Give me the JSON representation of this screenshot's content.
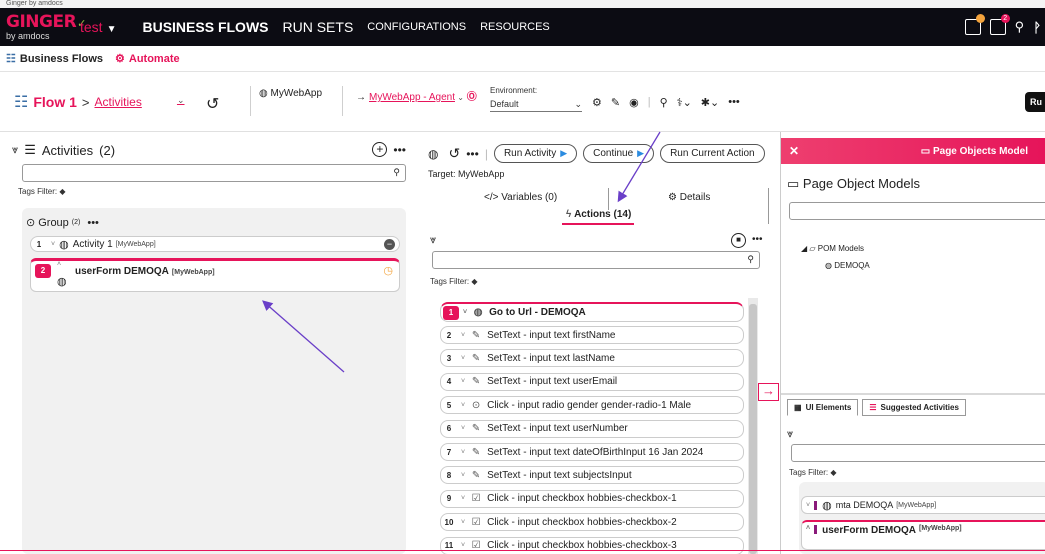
{
  "window": {
    "title": "Ginger by amdocs"
  },
  "brand": {
    "logo": "GINGER",
    "sub": "by amdocs"
  },
  "topnav": {
    "solution": "test",
    "items": [
      "BUSINESS FLOWS",
      "RUN SETS",
      "CONFIGURATIONS",
      "RESOURCES"
    ],
    "notification_count": "2"
  },
  "subbar": {
    "business_flows": "Business Flows",
    "automate": "Automate"
  },
  "toolbar": {
    "flow_name": "Flow 1",
    "flow_sep": ">",
    "view": "Activities",
    "app": "MyWebApp",
    "agent": "MyWebApp - Agent",
    "env_label": "Environment:",
    "env_value": "Default",
    "run": "Ru"
  },
  "activities": {
    "title": "Activities",
    "count": "(2)",
    "tags_filter": "Tags Filter:",
    "group_label": "Group",
    "group_count": "(2)",
    "items": [
      {
        "num": "1",
        "name": "Activity 1",
        "app": "[MyWebApp]"
      },
      {
        "num": "2",
        "name": "userForm DEMOQA",
        "app": "[MyWebApp]"
      }
    ]
  },
  "actions_panel": {
    "run_activity": "Run Activity",
    "continue": "Continue",
    "run_current_action": "Run Current Action",
    "target": "Target: MyWebApp",
    "tab_variables": "Variables (0)",
    "tab_details": "Details",
    "tab_actions": "Actions (14)",
    "tags_filter": "Tags Filter:",
    "items": [
      {
        "num": "1",
        "icon": "globe",
        "text": "Go to Url - DEMOQA"
      },
      {
        "num": "2",
        "icon": "pencil",
        "text": "SetText - input text firstName"
      },
      {
        "num": "3",
        "icon": "pencil",
        "text": "SetText - input text lastName"
      },
      {
        "num": "4",
        "icon": "pencil",
        "text": "SetText - input text userEmail"
      },
      {
        "num": "5",
        "icon": "radio",
        "text": "Click - input radio gender gender-radio-1 Male"
      },
      {
        "num": "6",
        "icon": "pencil",
        "text": "SetText - input text userNumber"
      },
      {
        "num": "7",
        "icon": "pencil",
        "text": "SetText - input text dateOfBirthInput 16 Jan 2024"
      },
      {
        "num": "8",
        "icon": "pencil",
        "text": "SetText - input text subjectsInput"
      },
      {
        "num": "9",
        "icon": "checkbox",
        "text": "Click - input checkbox hobbies-checkbox-1"
      },
      {
        "num": "10",
        "icon": "checkbox",
        "text": "Click - input checkbox hobbies-checkbox-2"
      },
      {
        "num": "11",
        "icon": "checkbox",
        "text": "Click - input checkbox hobbies-checkbox-3"
      }
    ]
  },
  "pom": {
    "header": "Page Objects Model",
    "title": "Page Object Models",
    "tree_root": "POM Models",
    "tree_child": "DEMOQA",
    "tab_ui_elements": "UI Elements",
    "tab_suggested": "Suggested Activities",
    "tags_filter": "Tags Filter:",
    "items": [
      {
        "name": "mta DEMOQA",
        "app": "[MyWebApp]"
      },
      {
        "name": "userForm DEMOQA",
        "app": "[MyWebApp]"
      }
    ]
  },
  "colors": {
    "accent": "#e6145a",
    "nav_bg": "#0c0c13",
    "annotation": "#6a3fc8"
  }
}
